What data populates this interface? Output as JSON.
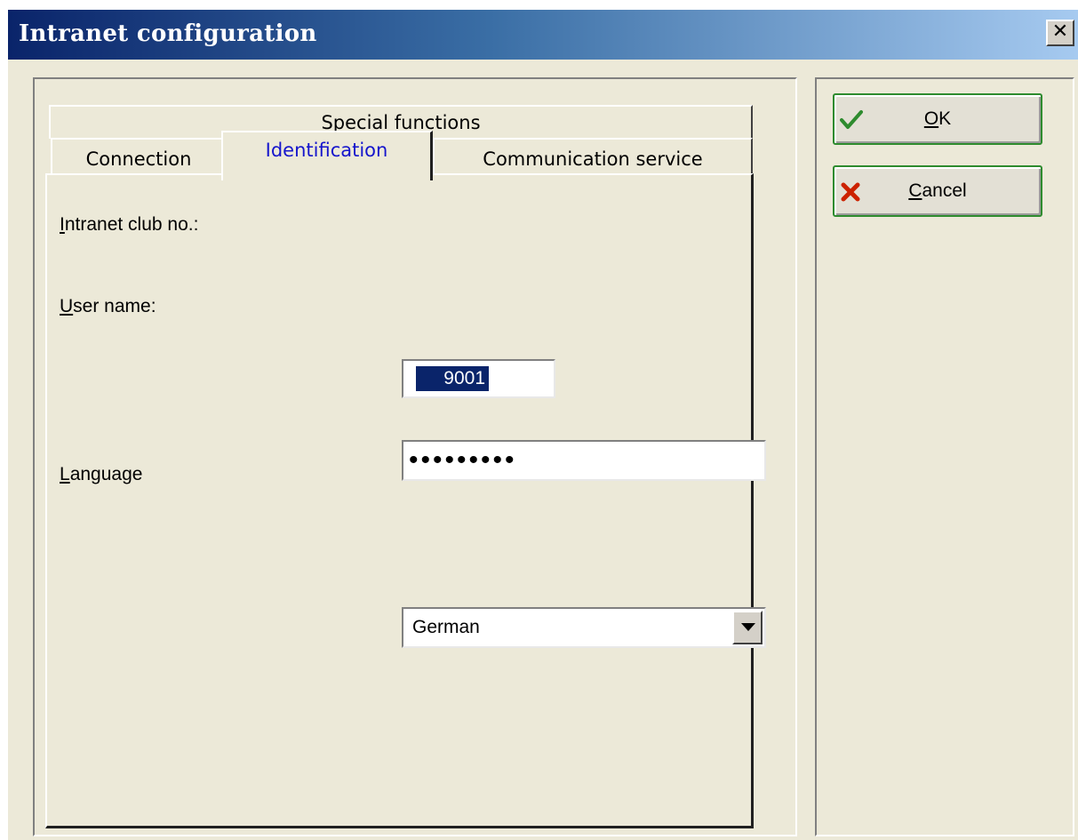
{
  "window": {
    "title": "Intranet configuration"
  },
  "tabs": {
    "row1": [
      {
        "label": "Special functions"
      }
    ],
    "row2": [
      {
        "label": "Connection"
      },
      {
        "label": "Identification"
      },
      {
        "label": "Communication service"
      }
    ],
    "active": "Identification"
  },
  "form": {
    "club_no": {
      "label_rest": "ntranet club no.:",
      "label_hotkey": "I",
      "value": "9001"
    },
    "user_name": {
      "label_rest": "ser name:",
      "label_hotkey": "U",
      "value_masked": "•••••••••"
    },
    "language": {
      "label_rest": "anguage",
      "label_hotkey": "L",
      "value": "German"
    }
  },
  "buttons": {
    "ok": {
      "hotkey": "O",
      "rest": "K",
      "icon": "check-icon"
    },
    "cancel": {
      "hotkey": "C",
      "rest": "ancel",
      "icon": "cross-icon"
    }
  },
  "colors": {
    "active_tab_text": "#1515cc",
    "selection": "#0a246a",
    "check": "#2e8b2e",
    "cross": "#cc2200"
  }
}
